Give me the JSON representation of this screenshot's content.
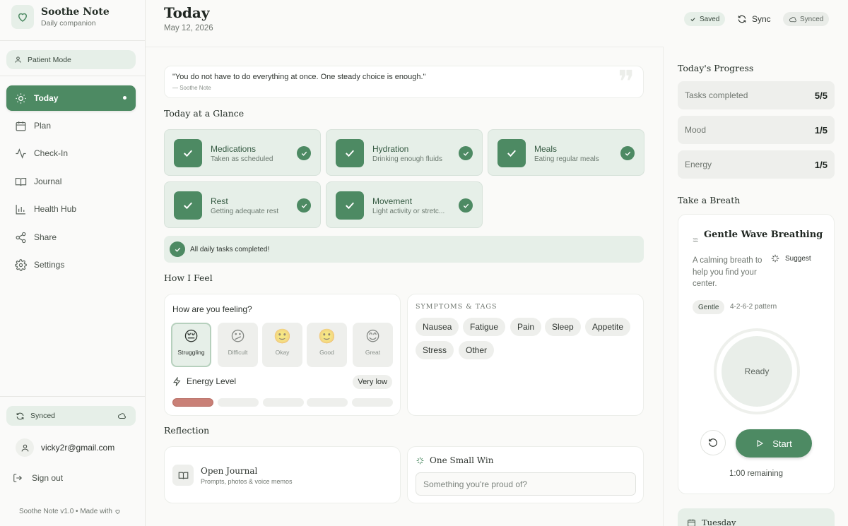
{
  "app": {
    "name": "Soothe Note",
    "tagline": "Daily companion",
    "version_note": "Soothe Note v1.0 • Made with"
  },
  "sidebar": {
    "mode_label": "Patient Mode",
    "items": [
      {
        "label": "Today",
        "icon": "sun-icon",
        "active": true
      },
      {
        "label": "Plan",
        "icon": "calendar-icon"
      },
      {
        "label": "Check-In",
        "icon": "activity-icon"
      },
      {
        "label": "Journal",
        "icon": "book-icon"
      },
      {
        "label": "Health Hub",
        "icon": "bar-chart-icon"
      },
      {
        "label": "Share",
        "icon": "share-icon"
      },
      {
        "label": "Settings",
        "icon": "gear-icon"
      }
    ],
    "sync_label": "Synced",
    "user_email": "vicky2r@gmail.com",
    "signout_label": "Sign out"
  },
  "header": {
    "title": "Today",
    "date": "May 12, 2026",
    "saved_label": "Saved",
    "sync_label": "Sync",
    "synced_label": "Synced"
  },
  "quote": {
    "text": "\"You do not have to do everything at once. One steady choice is enough.\"",
    "attribution": "— Soothe Note"
  },
  "glance": {
    "title": "Today at a Glance",
    "cards": [
      {
        "title": "Medications",
        "subtitle": "Taken as scheduled"
      },
      {
        "title": "Hydration",
        "subtitle": "Drinking enough fluids"
      },
      {
        "title": "Meals",
        "subtitle": "Eating regular meals"
      },
      {
        "title": "Rest",
        "subtitle": "Getting adequate rest"
      },
      {
        "title": "Movement",
        "subtitle": "Light activity or stretc..."
      }
    ],
    "all_done": "All daily tasks completed!"
  },
  "feel": {
    "title": "How I Feel",
    "question": "How are you feeling?",
    "moods": [
      {
        "label": "Struggling",
        "face": "😔",
        "selected": true
      },
      {
        "label": "Difficult",
        "face": "😕"
      },
      {
        "label": "Okay",
        "face": "🙂"
      },
      {
        "label": "Good",
        "face": "🙂"
      },
      {
        "label": "Great",
        "face": "😊"
      }
    ],
    "energy_label": "Energy Level",
    "energy_value": "Very low",
    "energy_level": 1,
    "energy_max": 5
  },
  "symptoms": {
    "title": "SYMPTOMS & TAGS",
    "tags": [
      "Nausea",
      "Fatigue",
      "Pain",
      "Sleep",
      "Appetite",
      "Stress",
      "Other"
    ]
  },
  "reflection": {
    "title": "Reflection",
    "journal_title": "Open Journal",
    "journal_sub": "Prompts, photos & voice memos",
    "win_title": "One Small Win",
    "win_placeholder": "Something you're proud of?"
  },
  "progress": {
    "title": "Today's Progress",
    "rows": [
      {
        "label": "Tasks completed",
        "value": "5/5"
      },
      {
        "label": "Mood",
        "value": "1/5"
      },
      {
        "label": "Energy",
        "value": "1/5"
      }
    ]
  },
  "breath": {
    "section_title": "Take a Breath",
    "name": "Gentle Wave Breathing",
    "description": "A calming breath to help you find your center.",
    "suggest_label": "Suggest",
    "tag": "Gentle",
    "pattern": "4-2-6-2 pattern",
    "state": "Ready",
    "start_label": "Start",
    "remaining": "1:00 remaining"
  },
  "upcoming": {
    "day": "Tuesday"
  },
  "colors": {
    "accent": "#4d8a63",
    "accent_soft": "#e6efe8",
    "energy_low": "#c98077"
  }
}
